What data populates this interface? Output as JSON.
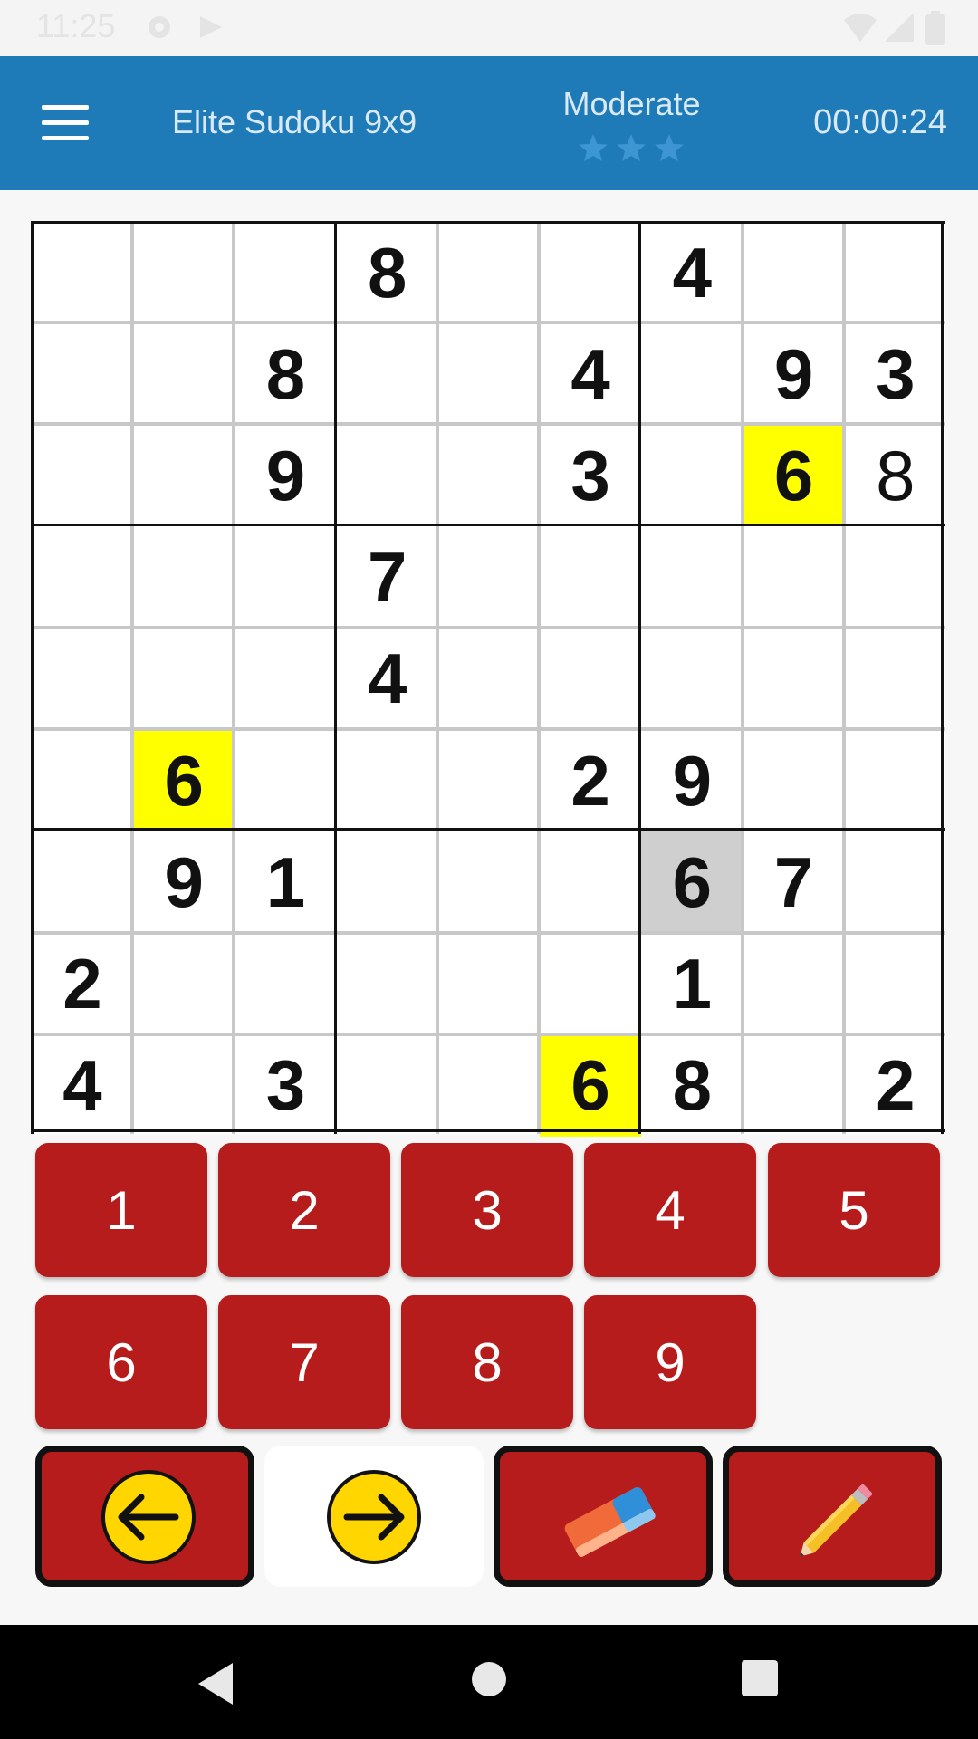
{
  "status_bar": {
    "time": "11:25"
  },
  "app_bar": {
    "title": "Elite Sudoku 9x9",
    "difficulty": "Moderate",
    "difficulty_stars": 3,
    "timer": "00:00:24"
  },
  "board": {
    "rows": [
      [
        "",
        "",
        "",
        "8",
        "",
        "",
        "4",
        "",
        ""
      ],
      [
        "",
        "",
        "8",
        "",
        "",
        "4",
        "",
        "9",
        "3"
      ],
      [
        "",
        "",
        "9",
        "",
        "",
        "3",
        "",
        "6",
        "8"
      ],
      [
        "",
        "",
        "",
        "7",
        "",
        "",
        "",
        "",
        ""
      ],
      [
        "",
        "",
        "",
        "4",
        "",
        "",
        "",
        "",
        ""
      ],
      [
        "",
        "6",
        "",
        "",
        "",
        "2",
        "9",
        "",
        ""
      ],
      [
        "",
        "9",
        "1",
        "",
        "",
        "",
        "6",
        "7",
        ""
      ],
      [
        "2",
        "",
        "",
        "",
        "",
        "",
        "1",
        "",
        ""
      ],
      [
        "4",
        "",
        "3",
        "",
        "",
        "6",
        "8",
        "",
        "2"
      ]
    ],
    "user_entered_cells": [
      "2-8"
    ],
    "highlighted_cells": [
      "2-7",
      "5-1",
      "8-5"
    ],
    "selected_cell": "6-6",
    "highlight_color": "#ffff00",
    "selected_color": "#cfcfcf"
  },
  "keypad": {
    "row1": [
      "1",
      "2",
      "3",
      "4",
      "5"
    ],
    "row2": [
      "6",
      "7",
      "8",
      "9"
    ],
    "button_color": "#b71c1c"
  },
  "tools": {
    "undo": "arrow-left-icon",
    "redo": "arrow-right-icon",
    "erase": "eraser-icon",
    "notes": "pencil-icon"
  },
  "colors": {
    "app_bar": "#1f7ab8",
    "accent_yellow": "#ffd600"
  }
}
